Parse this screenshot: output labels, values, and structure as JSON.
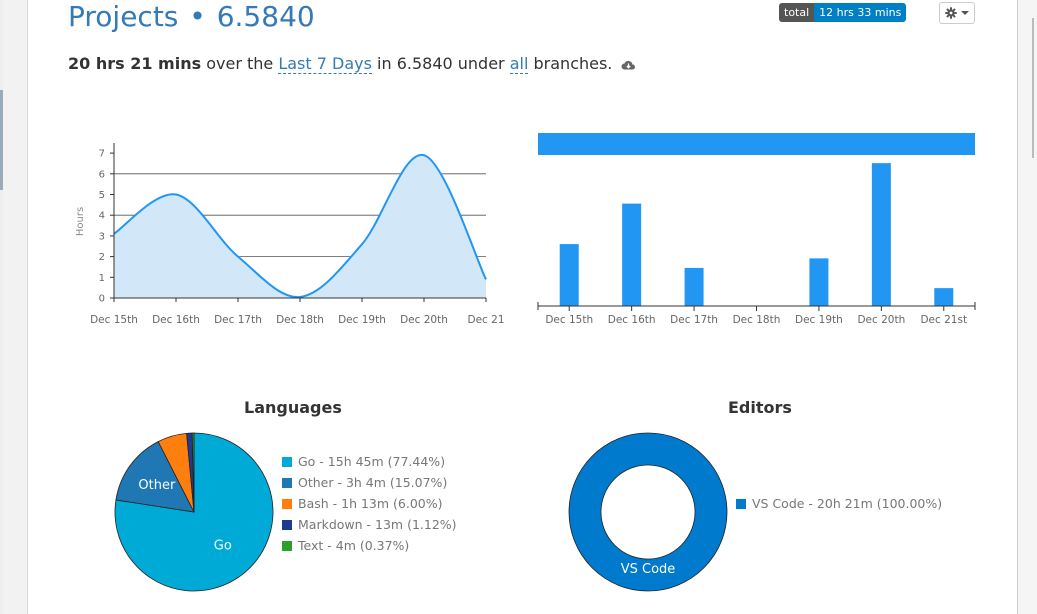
{
  "header": {
    "title_prefix": "Projects",
    "title_sep": "•",
    "project_name": "6.5840",
    "total_label": "total",
    "total_value": "12 hrs 33 mins"
  },
  "summary": {
    "duration": "20 hrs 21 mins",
    "text_over_the": " over the ",
    "range_link": "Last 7 Days",
    "text_in": " in 6.5840 under ",
    "branches_link": "all",
    "text_branches": " branches."
  },
  "colors": {
    "accent": "#337ab7",
    "line": "#2196f3",
    "area_fill": "#d2e8f9",
    "bar": "#2196f3",
    "editor_donut": "#007acc"
  },
  "chart_data": [
    {
      "type": "area",
      "ylabel": "Hours",
      "ylim": [
        0,
        7.3
      ],
      "yticks": [
        "0",
        "1",
        "2",
        "3",
        "4",
        "5",
        "6",
        "7"
      ],
      "gridlines": [
        2,
        4,
        6
      ],
      "categories": [
        "Dec 15th",
        "Dec 16th",
        "Dec 17th",
        "Dec 18th",
        "Dec 19th",
        "Dec 20th",
        "Dec 21"
      ],
      "values": [
        3.1,
        5.0,
        2.0,
        0.05,
        2.6,
        6.9,
        0.9
      ]
    },
    {
      "type": "bar",
      "categories": [
        "Dec 15th",
        "Dec 16th",
        "Dec 17th",
        "Dec 18th",
        "Dec 19th",
        "Dec 20th",
        "Dec 21st"
      ],
      "values": [
        2.6,
        4.3,
        1.6,
        0,
        2.0,
        6.0,
        0.75
      ],
      "ylim": [
        0,
        6.3
      ]
    },
    {
      "type": "pie",
      "title": "Languages",
      "slices": [
        {
          "name": "Go",
          "label": "Go - 15h 45m (77.44%)",
          "value": 77.44,
          "color": "#00aad6",
          "slice_label": "Go"
        },
        {
          "name": "Other",
          "label": "Other - 3h 4m (15.07%)",
          "value": 15.07,
          "color": "#1f77b4",
          "slice_label": "Other"
        },
        {
          "name": "Bash",
          "label": "Bash - 1h 13m (6.00%)",
          "value": 6.0,
          "color": "#ff7f0e",
          "slice_label": ""
        },
        {
          "name": "Markdown",
          "label": "Markdown - 13m (1.12%)",
          "value": 1.12,
          "color": "#203a91",
          "slice_label": ""
        },
        {
          "name": "Text",
          "label": "Text - 4m (0.37%)",
          "value": 0.37,
          "color": "#2ca02c",
          "slice_label": ""
        }
      ]
    },
    {
      "type": "pie",
      "title": "Editors",
      "slices": [
        {
          "name": "VS Code",
          "label": "VS Code - 20h 21m (100.00%)",
          "value": 100.0,
          "color": "#007acc",
          "slice_label": "VS Code"
        }
      ]
    }
  ]
}
